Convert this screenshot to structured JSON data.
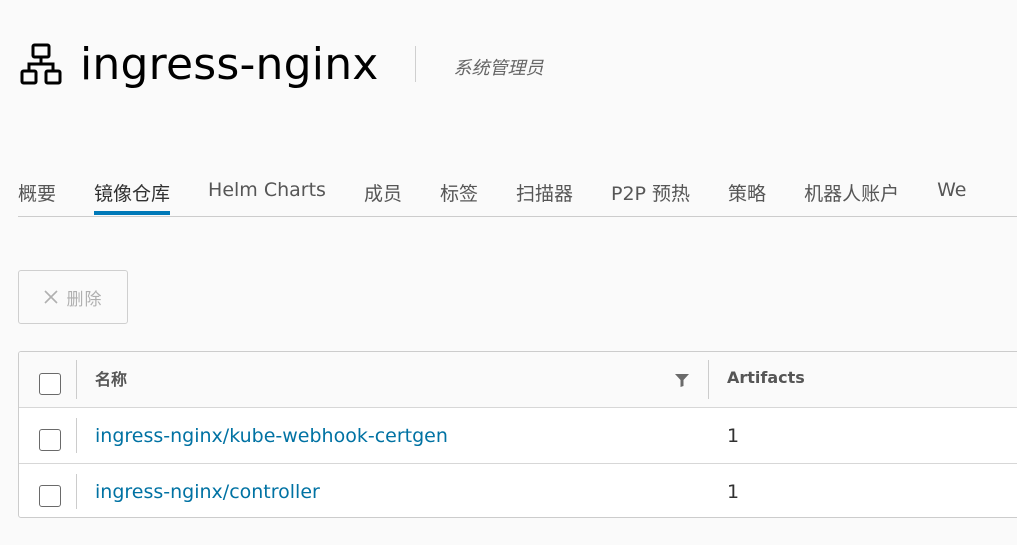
{
  "header": {
    "project_name": "ingress-nginx",
    "role": "系统管理员",
    "icon": "project-network-icon"
  },
  "tabs": [
    {
      "label": "概要",
      "active": false
    },
    {
      "label": "镜像仓库",
      "active": true
    },
    {
      "label": "Helm Charts",
      "active": false
    },
    {
      "label": "成员",
      "active": false
    },
    {
      "label": "标签",
      "active": false
    },
    {
      "label": "扫描器",
      "active": false
    },
    {
      "label": "P2P 预热",
      "active": false
    },
    {
      "label": "策略",
      "active": false
    },
    {
      "label": "机器人账户",
      "active": false
    },
    {
      "label": "We",
      "active": false
    }
  ],
  "toolbar": {
    "delete_label": "删除",
    "delete_icon": "close-icon",
    "delete_enabled": false
  },
  "table": {
    "columns": {
      "name": "名称",
      "artifacts": "Artifacts"
    },
    "rows": [
      {
        "name": "ingress-nginx/kube-webhook-certgen",
        "artifacts": "1"
      },
      {
        "name": "ingress-nginx/controller",
        "artifacts": "1"
      }
    ]
  },
  "colors": {
    "accent": "#0079b8",
    "link": "#0072a3"
  }
}
